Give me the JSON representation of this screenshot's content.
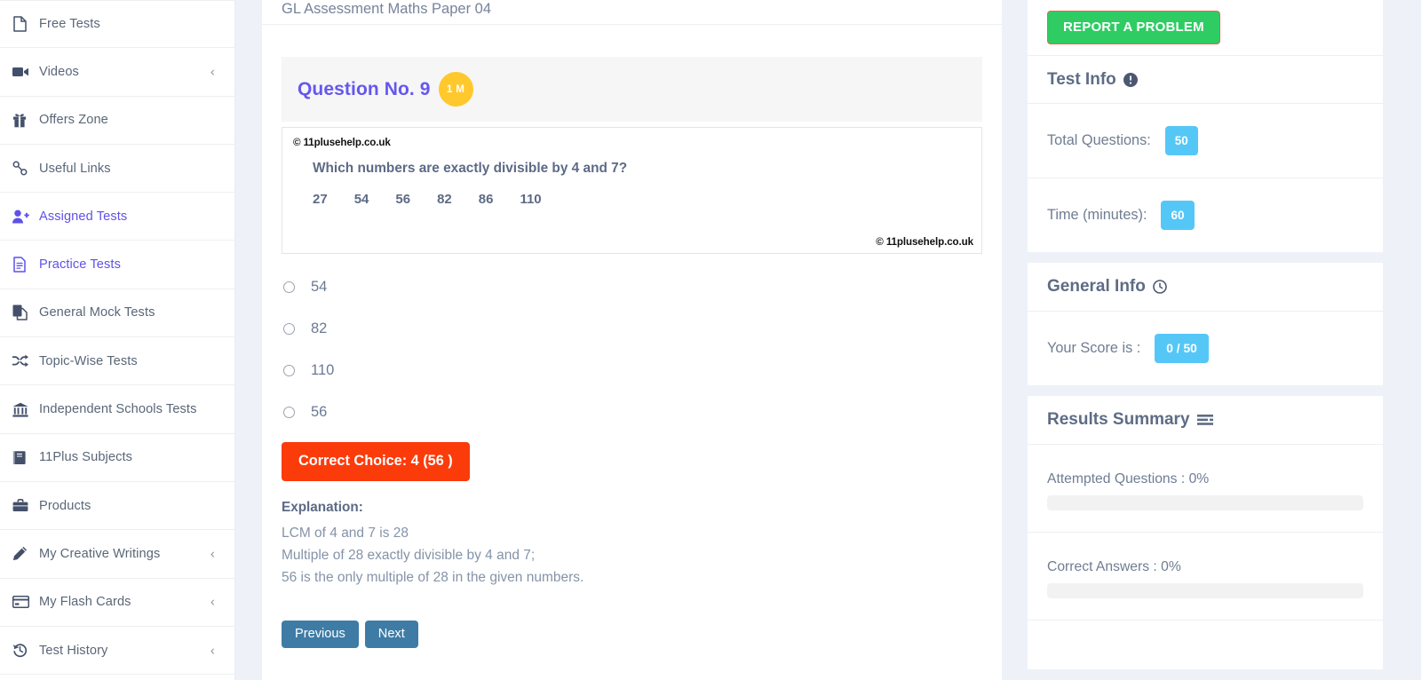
{
  "sidebar": {
    "items": [
      {
        "label": "Free Tests",
        "icon": "file-icon",
        "chevron": false,
        "active": false
      },
      {
        "label": "Videos",
        "icon": "video-camera-icon",
        "chevron": true,
        "active": false
      },
      {
        "label": "Offers Zone",
        "icon": "gift-icon",
        "chevron": false,
        "active": false
      },
      {
        "label": "Useful Links",
        "icon": "link-icon",
        "chevron": false,
        "active": false
      },
      {
        "label": "Assigned Tests",
        "icon": "user-plus-icon",
        "chevron": false,
        "active": true
      },
      {
        "label": "Practice Tests",
        "icon": "document-lines-icon",
        "chevron": false,
        "active": true
      },
      {
        "label": "General Mock Tests",
        "icon": "copy-icon",
        "chevron": false,
        "active": false
      },
      {
        "label": "Topic-Wise Tests",
        "icon": "shuffle-icon",
        "chevron": false,
        "active": false
      },
      {
        "label": "Independent Schools Tests",
        "icon": "bank-icon",
        "chevron": false,
        "active": false
      },
      {
        "label": "11Plus Subjects",
        "icon": "book-icon",
        "chevron": false,
        "active": false
      },
      {
        "label": "Products",
        "icon": "briefcase-icon",
        "chevron": false,
        "active": false
      },
      {
        "label": "My Creative Writings",
        "icon": "pencil-icon",
        "chevron": true,
        "active": false
      },
      {
        "label": "My Flash Cards",
        "icon": "card-icon",
        "chevron": true,
        "active": false
      },
      {
        "label": "Test History",
        "icon": "history-icon",
        "chevron": true,
        "active": false
      }
    ],
    "chevron_glyph": "‹"
  },
  "main": {
    "test_title": "GL Assessment Maths Paper 04",
    "question_label": "Question No. 9",
    "marks_badge": "1 M",
    "watermark_top": "© 11plusehelp.co.uk",
    "watermark_bottom": "© 11plusehelp.co.uk",
    "question_text": "Which numbers are exactly divisible by 4 and 7?",
    "question_numbers": [
      "27",
      "54",
      "56",
      "82",
      "86",
      "110"
    ],
    "options": [
      {
        "label": "54",
        "selected": false
      },
      {
        "label": "82",
        "selected": false
      },
      {
        "label": "110",
        "selected": false
      },
      {
        "label": "56",
        "selected": false
      }
    ],
    "correct_choice": "Correct Choice: 4 (56 )",
    "explanation_title": "Explanation:",
    "explanation_lines": [
      "LCM of 4 and 7 is 28",
      "Multiple of 28 exactly divisible by 4 and 7;",
      "56 is the only multiple of 28 in the given numbers."
    ],
    "previous_label": "Previous",
    "next_label": "Next"
  },
  "right": {
    "report_button": "REPORT A PROBLEM",
    "test_info": {
      "heading": "Test Info",
      "rows": [
        {
          "label": "Total Questions:",
          "value": "50"
        },
        {
          "label": "Time (minutes):",
          "value": "60"
        }
      ]
    },
    "general_info": {
      "heading": "General Info",
      "rows": [
        {
          "label": "Your Score is :",
          "value": "0 / 50"
        }
      ]
    },
    "results_summary": {
      "heading": "Results Summary",
      "bars": [
        {
          "label": "Attempted Questions : 0%",
          "percent": 0
        },
        {
          "label": "Correct Answers : 0%",
          "percent": 0
        }
      ]
    }
  },
  "colors": {
    "accent_purple": "#6557ee",
    "badge_yellow": "#ffc82c",
    "correct_red": "#fc3b0b",
    "nav_blue": "#3e7ca6",
    "report_green": "#2ecc63",
    "info_blue": "#55c7f7",
    "page_bg": "#eef2f8"
  }
}
